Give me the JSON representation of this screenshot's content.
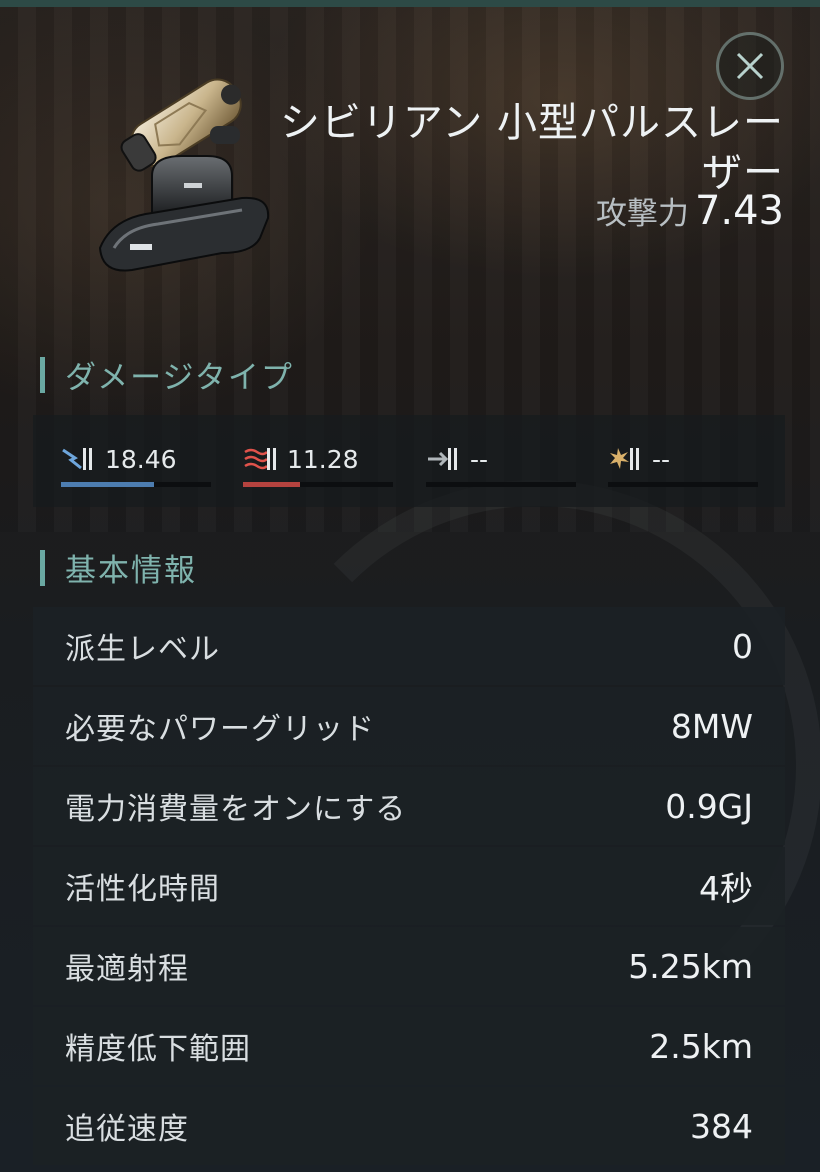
{
  "item": {
    "name": "シビリアン 小型パルスレーザー",
    "attack_label": "攻撃力",
    "attack_value": "7.43",
    "icon": "pulse-laser-turret-icon"
  },
  "close_icon": "close-icon",
  "damage_section": {
    "title": "ダメージタイプ",
    "types": [
      {
        "icon": "em-damage-icon",
        "value": "18.46",
        "fill": 0.62,
        "color": "#4d7db0"
      },
      {
        "icon": "thermal-damage-icon",
        "value": "11.28",
        "fill": 0.38,
        "color": "#b5433f"
      },
      {
        "icon": "kinetic-damage-icon",
        "value": "--",
        "fill": 0,
        "color": "#8a9095"
      },
      {
        "icon": "explosive-damage-icon",
        "value": "--",
        "fill": 0,
        "color": "#c9a05a"
      }
    ]
  },
  "basic_section": {
    "title": "基本情報",
    "rows": [
      {
        "label": "派生レベル",
        "value": "0"
      },
      {
        "label": "必要なパワーグリッド",
        "value": "8MW"
      },
      {
        "label": "電力消費量をオンにする",
        "value": "0.9GJ"
      },
      {
        "label": "活性化時間",
        "value": "4秒"
      },
      {
        "label": "最適射程",
        "value": "5.25km"
      },
      {
        "label": "精度低下範囲",
        "value": "2.5km"
      },
      {
        "label": "追従速度",
        "value": "384"
      }
    ]
  },
  "colors": {
    "accent": "#6aa8a2",
    "em": "#4d7db0",
    "thermal": "#b5433f"
  }
}
